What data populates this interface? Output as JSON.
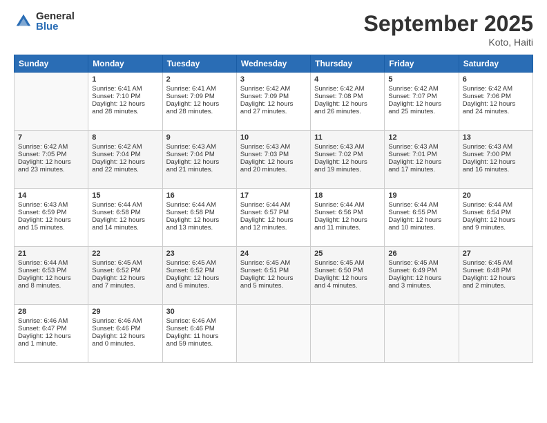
{
  "logo": {
    "general": "General",
    "blue": "Blue"
  },
  "title": "September 2025",
  "subtitle": "Koto, Haiti",
  "days_header": [
    "Sunday",
    "Monday",
    "Tuesday",
    "Wednesday",
    "Thursday",
    "Friday",
    "Saturday"
  ],
  "weeks": [
    [
      {
        "day": "",
        "info": ""
      },
      {
        "day": "1",
        "info": "Sunrise: 6:41 AM\nSunset: 7:10 PM\nDaylight: 12 hours\nand 28 minutes."
      },
      {
        "day": "2",
        "info": "Sunrise: 6:41 AM\nSunset: 7:09 PM\nDaylight: 12 hours\nand 28 minutes."
      },
      {
        "day": "3",
        "info": "Sunrise: 6:42 AM\nSunset: 7:09 PM\nDaylight: 12 hours\nand 27 minutes."
      },
      {
        "day": "4",
        "info": "Sunrise: 6:42 AM\nSunset: 7:08 PM\nDaylight: 12 hours\nand 26 minutes."
      },
      {
        "day": "5",
        "info": "Sunrise: 6:42 AM\nSunset: 7:07 PM\nDaylight: 12 hours\nand 25 minutes."
      },
      {
        "day": "6",
        "info": "Sunrise: 6:42 AM\nSunset: 7:06 PM\nDaylight: 12 hours\nand 24 minutes."
      }
    ],
    [
      {
        "day": "7",
        "info": "Sunrise: 6:42 AM\nSunset: 7:05 PM\nDaylight: 12 hours\nand 23 minutes."
      },
      {
        "day": "8",
        "info": "Sunrise: 6:42 AM\nSunset: 7:04 PM\nDaylight: 12 hours\nand 22 minutes."
      },
      {
        "day": "9",
        "info": "Sunrise: 6:43 AM\nSunset: 7:04 PM\nDaylight: 12 hours\nand 21 minutes."
      },
      {
        "day": "10",
        "info": "Sunrise: 6:43 AM\nSunset: 7:03 PM\nDaylight: 12 hours\nand 20 minutes."
      },
      {
        "day": "11",
        "info": "Sunrise: 6:43 AM\nSunset: 7:02 PM\nDaylight: 12 hours\nand 19 minutes."
      },
      {
        "day": "12",
        "info": "Sunrise: 6:43 AM\nSunset: 7:01 PM\nDaylight: 12 hours\nand 17 minutes."
      },
      {
        "day": "13",
        "info": "Sunrise: 6:43 AM\nSunset: 7:00 PM\nDaylight: 12 hours\nand 16 minutes."
      }
    ],
    [
      {
        "day": "14",
        "info": "Sunrise: 6:43 AM\nSunset: 6:59 PM\nDaylight: 12 hours\nand 15 minutes."
      },
      {
        "day": "15",
        "info": "Sunrise: 6:44 AM\nSunset: 6:58 PM\nDaylight: 12 hours\nand 14 minutes."
      },
      {
        "day": "16",
        "info": "Sunrise: 6:44 AM\nSunset: 6:58 PM\nDaylight: 12 hours\nand 13 minutes."
      },
      {
        "day": "17",
        "info": "Sunrise: 6:44 AM\nSunset: 6:57 PM\nDaylight: 12 hours\nand 12 minutes."
      },
      {
        "day": "18",
        "info": "Sunrise: 6:44 AM\nSunset: 6:56 PM\nDaylight: 12 hours\nand 11 minutes."
      },
      {
        "day": "19",
        "info": "Sunrise: 6:44 AM\nSunset: 6:55 PM\nDaylight: 12 hours\nand 10 minutes."
      },
      {
        "day": "20",
        "info": "Sunrise: 6:44 AM\nSunset: 6:54 PM\nDaylight: 12 hours\nand 9 minutes."
      }
    ],
    [
      {
        "day": "21",
        "info": "Sunrise: 6:44 AM\nSunset: 6:53 PM\nDaylight: 12 hours\nand 8 minutes."
      },
      {
        "day": "22",
        "info": "Sunrise: 6:45 AM\nSunset: 6:52 PM\nDaylight: 12 hours\nand 7 minutes."
      },
      {
        "day": "23",
        "info": "Sunrise: 6:45 AM\nSunset: 6:52 PM\nDaylight: 12 hours\nand 6 minutes."
      },
      {
        "day": "24",
        "info": "Sunrise: 6:45 AM\nSunset: 6:51 PM\nDaylight: 12 hours\nand 5 minutes."
      },
      {
        "day": "25",
        "info": "Sunrise: 6:45 AM\nSunset: 6:50 PM\nDaylight: 12 hours\nand 4 minutes."
      },
      {
        "day": "26",
        "info": "Sunrise: 6:45 AM\nSunset: 6:49 PM\nDaylight: 12 hours\nand 3 minutes."
      },
      {
        "day": "27",
        "info": "Sunrise: 6:45 AM\nSunset: 6:48 PM\nDaylight: 12 hours\nand 2 minutes."
      }
    ],
    [
      {
        "day": "28",
        "info": "Sunrise: 6:46 AM\nSunset: 6:47 PM\nDaylight: 12 hours\nand 1 minute."
      },
      {
        "day": "29",
        "info": "Sunrise: 6:46 AM\nSunset: 6:46 PM\nDaylight: 12 hours\nand 0 minutes."
      },
      {
        "day": "30",
        "info": "Sunrise: 6:46 AM\nSunset: 6:46 PM\nDaylight: 11 hours\nand 59 minutes."
      },
      {
        "day": "",
        "info": ""
      },
      {
        "day": "",
        "info": ""
      },
      {
        "day": "",
        "info": ""
      },
      {
        "day": "",
        "info": ""
      }
    ]
  ]
}
